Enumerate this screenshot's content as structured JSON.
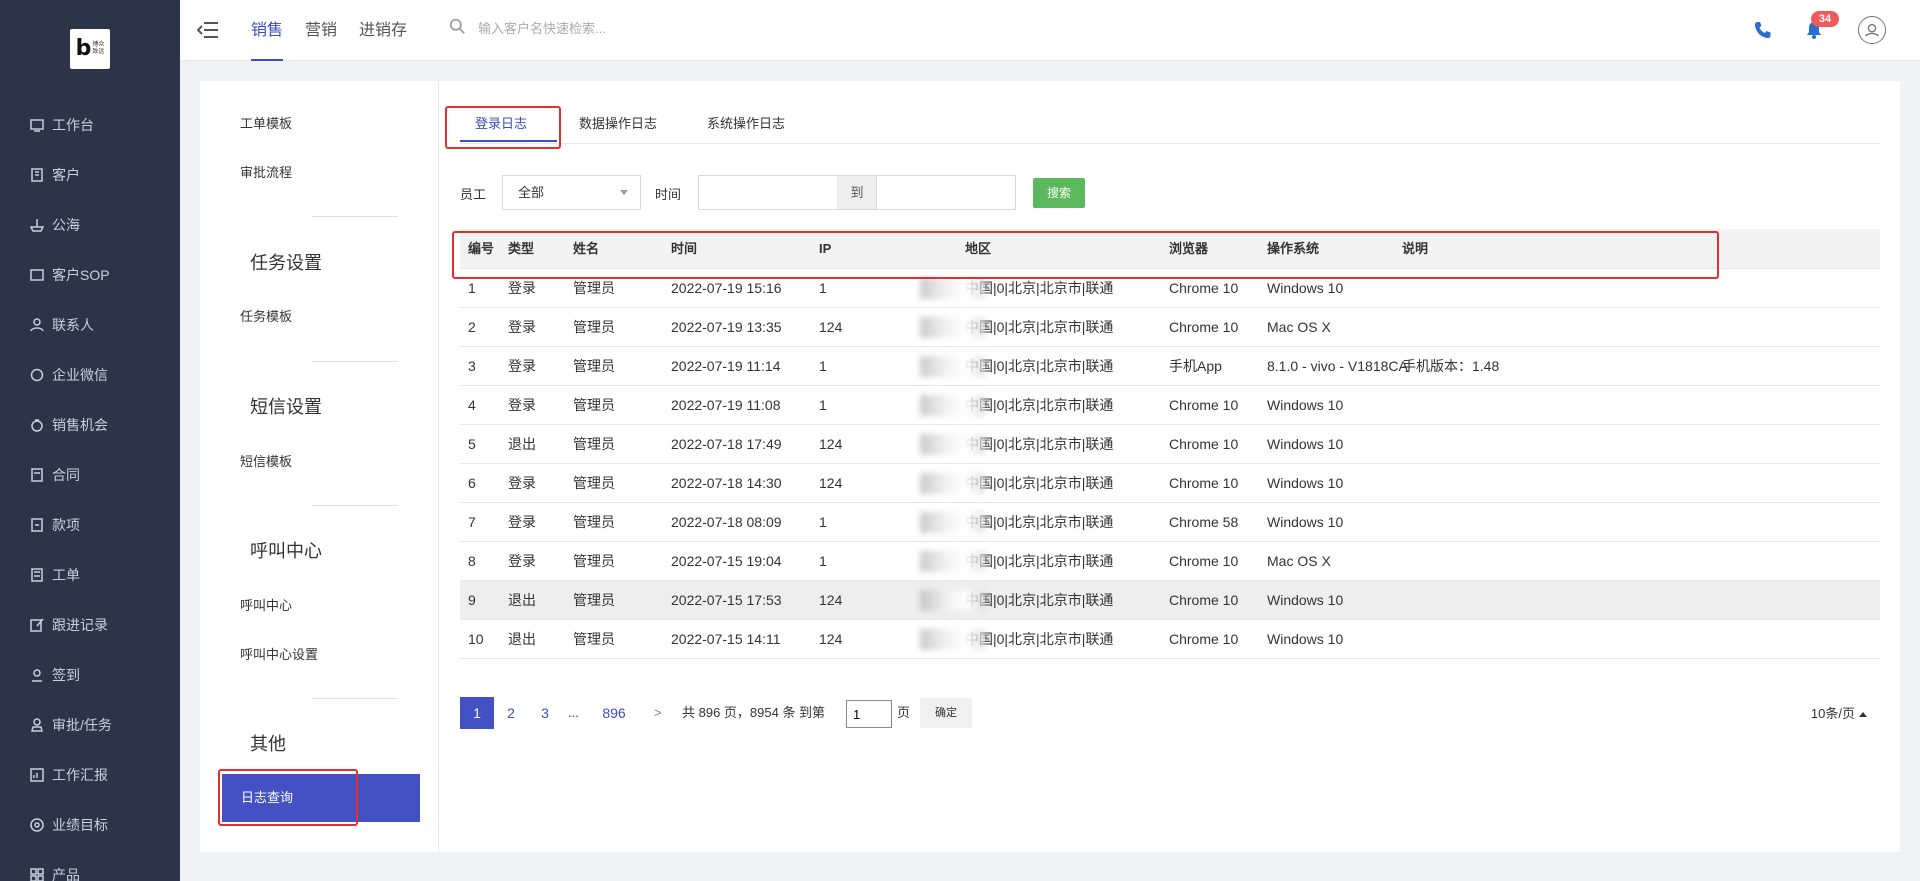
{
  "logo": {
    "letter": "b",
    "name_line1": "博众",
    "name_line2": "致远"
  },
  "sidebar": {
    "items": [
      {
        "label": "工作台",
        "icon": "monitor-icon"
      },
      {
        "label": "客户",
        "icon": "building-icon"
      },
      {
        "label": "公海",
        "icon": "ship-icon"
      },
      {
        "label": "客户SOP",
        "icon": "sop-icon"
      },
      {
        "label": "联系人",
        "icon": "contact-icon"
      },
      {
        "label": "企业微信",
        "icon": "chat-icon"
      },
      {
        "label": "销售机会",
        "icon": "money-bag-icon"
      },
      {
        "label": "合同",
        "icon": "contract-icon"
      },
      {
        "label": "款项",
        "icon": "payment-icon"
      },
      {
        "label": "工单",
        "icon": "ticket-icon"
      },
      {
        "label": "跟进记录",
        "icon": "edit-icon"
      },
      {
        "label": "签到",
        "icon": "location-icon"
      },
      {
        "label": "审批/任务",
        "icon": "approval-icon"
      },
      {
        "label": "工作汇报",
        "icon": "report-icon"
      },
      {
        "label": "业绩目标",
        "icon": "target-icon"
      },
      {
        "label": "产品",
        "icon": "grid-icon"
      }
    ]
  },
  "header": {
    "tabs": [
      "销售",
      "营销",
      "进销存"
    ],
    "active_tab": 0,
    "search_placeholder": "输入客户名快速检索...",
    "notification_count": "34"
  },
  "settings_nav": {
    "links_top": [
      "工单模板",
      "审批流程"
    ],
    "sections": [
      {
        "title": "任务设置",
        "links": [
          "任务模板"
        ]
      },
      {
        "title": "短信设置",
        "links": [
          "短信模板"
        ]
      },
      {
        "title": "呼叫中心",
        "links": [
          "呼叫中心",
          "呼叫中心设置"
        ]
      },
      {
        "title": "其他",
        "links": [
          "日志查询"
        ]
      }
    ],
    "active": "日志查询"
  },
  "log_tabs": [
    "登录日志",
    "数据操作日志",
    "系统操作日志"
  ],
  "filters": {
    "employee_label": "员工",
    "employee_value": "全部",
    "time_label": "时间",
    "range_separator": "到",
    "start_value": "",
    "end_value": "",
    "search_button": "搜索"
  },
  "table": {
    "columns": [
      "编号",
      "类型",
      "姓名",
      "时间",
      "IP",
      "地区",
      "浏览器",
      "操作系统",
      "说明"
    ],
    "rows": [
      [
        "1",
        "登录",
        "管理员",
        "2022-07-19 15:16",
        "1",
        "中国|0|北京|北京市|联通",
        "Chrome 10",
        "Windows 10",
        ""
      ],
      [
        "2",
        "登录",
        "管理员",
        "2022-07-19 13:35",
        "124",
        "中国|0|北京|北京市|联通",
        "Chrome 10",
        "Mac OS X",
        ""
      ],
      [
        "3",
        "登录",
        "管理员",
        "2022-07-19 11:14",
        "1",
        "中国|0|北京|北京市|联通",
        "手机App",
        "8.1.0 - vivo - V1818CA",
        "手机版本：1.48"
      ],
      [
        "4",
        "登录",
        "管理员",
        "2022-07-19 11:08",
        "1",
        "中国|0|北京|北京市|联通",
        "Chrome 10",
        "Windows 10",
        ""
      ],
      [
        "5",
        "退出",
        "管理员",
        "2022-07-18 17:49",
        "124",
        "中国|0|北京|北京市|联通",
        "Chrome 10",
        "Windows 10",
        ""
      ],
      [
        "6",
        "登录",
        "管理员",
        "2022-07-18 14:30",
        "124",
        "中国|0|北京|北京市|联通",
        "Chrome 10",
        "Windows 10",
        ""
      ],
      [
        "7",
        "登录",
        "管理员",
        "2022-07-18 08:09",
        "1",
        "中国|0|北京|北京市|联通",
        "Chrome 58",
        "Windows 10",
        ""
      ],
      [
        "8",
        "登录",
        "管理员",
        "2022-07-15 19:04",
        "1",
        "中国|0|北京|北京市|联通",
        "Chrome 10",
        "Mac OS X",
        ""
      ],
      [
        "9",
        "退出",
        "管理员",
        "2022-07-15 17:53",
        "124",
        "中国|0|北京|北京市|联通",
        "Chrome 10",
        "Windows 10",
        ""
      ],
      [
        "10",
        "退出",
        "管理员",
        "2022-07-15 14:11",
        "124",
        "中国|0|北京|北京市|联通",
        "Chrome 10",
        "Windows 10",
        ""
      ]
    ],
    "highlighted_row": 8
  },
  "pagination": {
    "pages": [
      "1",
      "2",
      "3"
    ],
    "ellipsis": "...",
    "last_page": "896",
    "next": ">",
    "summary": "共 896 页，8954 条 到第",
    "goto_value": "1",
    "page_unit": "页",
    "confirm": "确定",
    "per_page": "10条/页"
  },
  "colors": {
    "sidebar_bg": "#2b3547",
    "accent": "#4351c4",
    "search_green": "#5cb85c",
    "highlight_red": "#e0312f",
    "badge_red": "#f15a5a"
  }
}
